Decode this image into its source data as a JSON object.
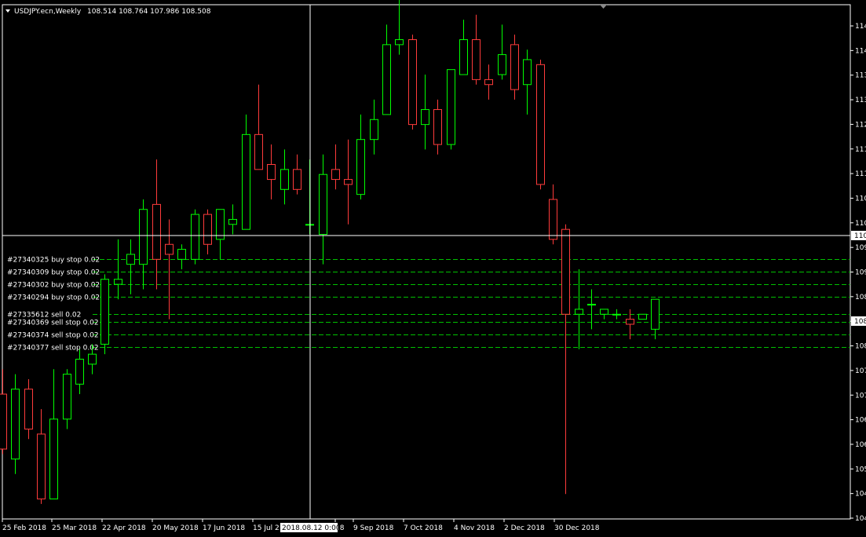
{
  "header": {
    "symbol_timeframe": "USDJPY.ecn,Weekly",
    "ohlc": "108.514 108.764 107.986 108.508"
  },
  "crosshair": {
    "time_label": "2018.08.12 0:00",
    "price_label": "110"
  },
  "current_price_label": "108",
  "colors": {
    "background": "#000000",
    "bull": "#00ff00",
    "bear": "#ff3b3b",
    "order_line": "#00c000",
    "axis": "#ffffff"
  },
  "orders": [
    {
      "label": "#27340325 buy stop 0.02",
      "price": 109.1
    },
    {
      "label": "#27340309 buy stop 0.02",
      "price": 108.85
    },
    {
      "label": "#27340302 buy stop 0.02",
      "price": 108.6
    },
    {
      "label": "#27340294 buy stop 0.02",
      "price": 108.35
    },
    {
      "label": "#27335612 sell 0.02",
      "price": 108.0
    },
    {
      "label": "#27340369 sell stop 0.02",
      "price": 107.85
    },
    {
      "label": "#27340374 sell stop 0.02",
      "price": 107.6
    },
    {
      "label": "#27340377 sell stop 0.02",
      "price": 107.35
    }
  ],
  "chart_data": {
    "type": "candlestick",
    "y_axis_ticks": [
      "114",
      "114",
      "113",
      "113",
      "112",
      "111",
      "111",
      "110",
      "110",
      "109",
      "109",
      "108",
      "108",
      "108",
      "107",
      "107",
      "106",
      "106",
      "105",
      "104",
      "104"
    ],
    "x_axis_labels": [
      "25 Feb 2018",
      "25 Mar 2018",
      "22 Apr 2018",
      "20 May 2018",
      "17 Jun 2018",
      "15 Jul 2",
      "18",
      "9 Sep 2018",
      "7 Oct 2018",
      "4 Nov 2018",
      "2 Dec 2018",
      "30 Dec 2018"
    ],
    "ylim": [
      103.9,
      114.2
    ],
    "candles": [
      {
        "o": 106.4,
        "h": 106.9,
        "l": 105.2,
        "c": 105.3
      },
      {
        "o": 105.1,
        "h": 106.8,
        "l": 104.8,
        "c": 106.5
      },
      {
        "o": 106.5,
        "h": 106.7,
        "l": 105.5,
        "c": 105.7
      },
      {
        "o": 105.6,
        "h": 106.1,
        "l": 104.2,
        "c": 104.3
      },
      {
        "o": 104.3,
        "h": 106.9,
        "l": 104.3,
        "c": 105.9
      },
      {
        "o": 105.9,
        "h": 106.9,
        "l": 105.7,
        "c": 106.8
      },
      {
        "o": 106.6,
        "h": 107.3,
        "l": 106.4,
        "c": 107.1
      },
      {
        "o": 107.0,
        "h": 107.4,
        "l": 106.8,
        "c": 107.2
      },
      {
        "o": 107.4,
        "h": 108.8,
        "l": 107.2,
        "c": 108.7
      },
      {
        "o": 108.6,
        "h": 109.5,
        "l": 108.3,
        "c": 108.7
      },
      {
        "o": 109.0,
        "h": 109.5,
        "l": 108.4,
        "c": 109.2
      },
      {
        "o": 109.0,
        "h": 110.3,
        "l": 108.5,
        "c": 110.1
      },
      {
        "o": 110.2,
        "h": 111.1,
        "l": 108.5,
        "c": 109.1
      },
      {
        "o": 109.4,
        "h": 109.9,
        "l": 107.9,
        "c": 109.2
      },
      {
        "o": 109.1,
        "h": 109.4,
        "l": 108.9,
        "c": 109.3
      },
      {
        "o": 109.1,
        "h": 110.1,
        "l": 109.0,
        "c": 110.0
      },
      {
        "o": 110.0,
        "h": 110.1,
        "l": 109.2,
        "c": 109.4
      },
      {
        "o": 109.5,
        "h": 110.0,
        "l": 109.1,
        "c": 110.1
      },
      {
        "o": 109.8,
        "h": 110.2,
        "l": 109.6,
        "c": 109.9
      },
      {
        "o": 109.7,
        "h": 112.0,
        "l": 109.7,
        "c": 111.6
      },
      {
        "o": 111.6,
        "h": 112.6,
        "l": 110.9,
        "c": 110.9
      },
      {
        "o": 111.0,
        "h": 111.4,
        "l": 110.3,
        "c": 110.7
      },
      {
        "o": 110.5,
        "h": 111.3,
        "l": 110.2,
        "c": 110.9
      },
      {
        "o": 110.9,
        "h": 111.2,
        "l": 110.4,
        "c": 110.5
      },
      {
        "o": 109.8,
        "h": 111.1,
        "l": 109.6,
        "c": 109.8
      },
      {
        "o": 109.6,
        "h": 111.2,
        "l": 109.0,
        "c": 110.8
      },
      {
        "o": 110.9,
        "h": 111.4,
        "l": 110.5,
        "c": 110.7
      },
      {
        "o": 110.7,
        "h": 111.5,
        "l": 109.8,
        "c": 110.6
      },
      {
        "o": 110.4,
        "h": 112.0,
        "l": 110.3,
        "c": 111.5
      },
      {
        "o": 111.5,
        "h": 112.3,
        "l": 111.2,
        "c": 111.9
      },
      {
        "o": 112.0,
        "h": 113.8,
        "l": 112.0,
        "c": 113.4
      },
      {
        "o": 113.4,
        "h": 114.3,
        "l": 113.2,
        "c": 113.5
      },
      {
        "o": 113.5,
        "h": 113.6,
        "l": 111.7,
        "c": 111.8
      },
      {
        "o": 111.8,
        "h": 112.8,
        "l": 111.3,
        "c": 112.1
      },
      {
        "o": 112.1,
        "h": 112.3,
        "l": 111.2,
        "c": 111.4
      },
      {
        "o": 111.4,
        "h": 112.9,
        "l": 111.3,
        "c": 112.9
      },
      {
        "o": 112.8,
        "h": 113.9,
        "l": 112.8,
        "c": 113.5
      },
      {
        "o": 113.5,
        "h": 114.0,
        "l": 112.6,
        "c": 112.7
      },
      {
        "o": 112.7,
        "h": 113.0,
        "l": 112.3,
        "c": 112.6
      },
      {
        "o": 112.8,
        "h": 113.8,
        "l": 112.7,
        "c": 113.2
      },
      {
        "o": 113.4,
        "h": 113.6,
        "l": 112.3,
        "c": 112.5
      },
      {
        "o": 112.6,
        "h": 113.3,
        "l": 112.0,
        "c": 113.1
      },
      {
        "o": 113.0,
        "h": 113.1,
        "l": 110.5,
        "c": 110.6
      },
      {
        "o": 110.3,
        "h": 110.6,
        "l": 109.4,
        "c": 109.5
      },
      {
        "o": 109.7,
        "h": 109.8,
        "l": 104.4,
        "c": 108.0
      },
      {
        "o": 108.0,
        "h": 108.9,
        "l": 107.3,
        "c": 108.1
      },
      {
        "o": 108.2,
        "h": 108.5,
        "l": 107.7,
        "c": 108.2
      },
      {
        "o": 108.0,
        "h": 108.1,
        "l": 107.9,
        "c": 108.1
      },
      {
        "o": 108.0,
        "h": 108.1,
        "l": 107.9,
        "c": 108.0
      },
      {
        "o": 107.9,
        "h": 108.1,
        "l": 107.5,
        "c": 107.8
      },
      {
        "o": 107.9,
        "h": 108.0,
        "l": 107.9,
        "c": 108.0
      },
      {
        "o": 107.7,
        "h": 108.3,
        "l": 107.5,
        "c": 108.3
      }
    ]
  }
}
